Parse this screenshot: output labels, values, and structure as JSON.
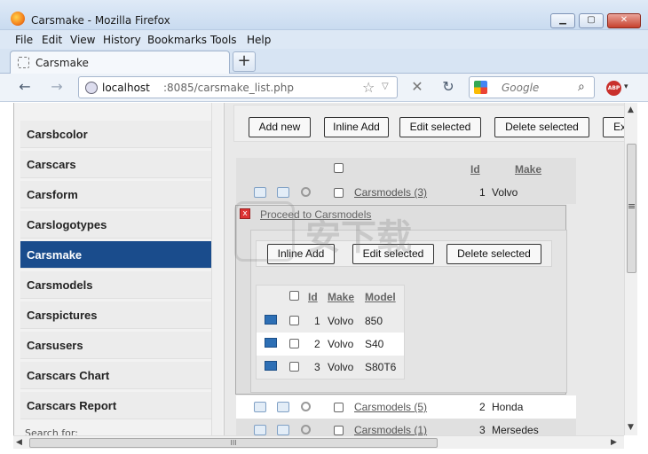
{
  "window": {
    "title": "Carsmake - Mozilla Firefox",
    "controls": {
      "minimize": "▁",
      "maximize": "▢",
      "close": "✕"
    }
  },
  "menu": [
    "File",
    "Edit",
    "View",
    "History",
    "Bookmarks",
    "Tools",
    "Help"
  ],
  "tab": {
    "label": "Carsmake",
    "new_tab": "+"
  },
  "nav": {
    "back": "←",
    "forward": "→",
    "url_host": "localhost",
    "url_path": ":8085/carsmake_list.php",
    "star": "☆",
    "dropdown": "▽",
    "stop": "✕",
    "reload": "↻",
    "search_placeholder": "Google",
    "search_btn": "⌕",
    "abp": "ABP",
    "abp_dropdown": "▾"
  },
  "sidebar": {
    "items": [
      {
        "label": "Carsbcolor",
        "active": false
      },
      {
        "label": "Carscars",
        "active": false
      },
      {
        "label": "Carsform",
        "active": false
      },
      {
        "label": "Carslogotypes",
        "active": false
      },
      {
        "label": "Carsmake",
        "active": true
      },
      {
        "label": "Carsmodels",
        "active": false
      },
      {
        "label": "Carspictures",
        "active": false
      },
      {
        "label": "Carsusers",
        "active": false
      },
      {
        "label": "Carscars Chart",
        "active": false
      },
      {
        "label": "Carscars Report",
        "active": false
      }
    ],
    "search_for": "Search for:"
  },
  "toolbar": {
    "add_new": "Add new",
    "inline_add": "Inline Add",
    "edit_selected": "Edit selected",
    "delete_selected": "Delete selected",
    "export": "Exp"
  },
  "grid": {
    "headers": {
      "id": "Id",
      "make": "Make"
    },
    "rows": [
      {
        "link": "Carsmodels (3)",
        "id": "1",
        "make": "Volvo"
      },
      {
        "link": "Carsmodels (5)",
        "id": "2",
        "make": "Honda"
      },
      {
        "link": "Carsmodels (1)",
        "id": "3",
        "make": "Mersedes"
      }
    ]
  },
  "popup": {
    "close": "x",
    "title": "Proceed to Carsmodels",
    "toolbar": {
      "inline_add": "Inline Add",
      "edit_selected": "Edit selected",
      "delete_selected": "Delete selected"
    },
    "headers": {
      "id": "Id",
      "make": "Make",
      "model": "Model"
    },
    "rows": [
      {
        "id": "1",
        "make": "Volvo",
        "model": "850"
      },
      {
        "id": "2",
        "make": "Volvo",
        "model": "S40"
      },
      {
        "id": "3",
        "make": "Volvo",
        "model": "S80T6"
      }
    ]
  },
  "watermark": {
    "text": "安下载"
  },
  "scrollbar": {
    "grip": "III",
    "up": "▲",
    "down": "▼",
    "left": "◀",
    "right": "▶",
    "side_grip": "≡"
  }
}
